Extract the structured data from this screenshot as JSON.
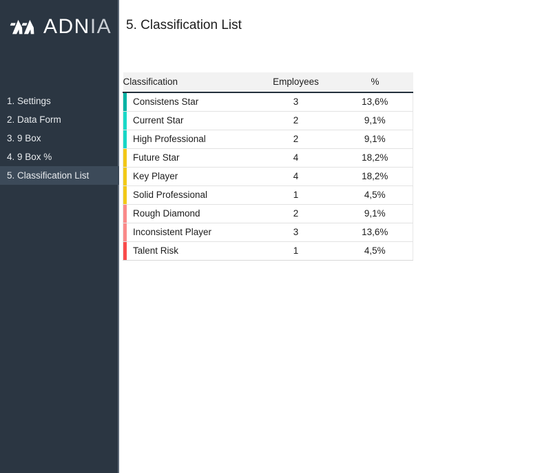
{
  "brand": {
    "logo_icon": "adnia-monogram-icon",
    "name_strong": "ADN",
    "name_light": "IA"
  },
  "sidebar": {
    "items": [
      {
        "label": "1. Settings",
        "active": false
      },
      {
        "label": "2. Data Form",
        "active": false
      },
      {
        "label": "3. 9 Box",
        "active": false
      },
      {
        "label": "4. 9 Box %",
        "active": false
      },
      {
        "label": "5. Classification List",
        "active": true
      }
    ],
    "background": "#2b3642",
    "active_background": "#3c4a59"
  },
  "main": {
    "page_title": "5. Classification List"
  },
  "table": {
    "headers": {
      "classification": "Classification",
      "employees": "Employees",
      "percent": "%"
    },
    "rows": [
      {
        "classification": "Consistens Star",
        "employees": "3",
        "percent": "13,6%",
        "color": "#00b3a4"
      },
      {
        "classification": "Current Star",
        "employees": "2",
        "percent": "9,1%",
        "color": "#1ad9c8"
      },
      {
        "classification": "High Professional",
        "employees": "2",
        "percent": "9,1%",
        "color": "#18d6c6"
      },
      {
        "classification": "Future Star",
        "employees": "4",
        "percent": "18,2%",
        "color": "#f2c718"
      },
      {
        "classification": "Key Player",
        "employees": "4",
        "percent": "18,2%",
        "color": "#f2ca18"
      },
      {
        "classification": "Solid Professional",
        "employees": "1",
        "percent": "4,5%",
        "color": "#f2c918"
      },
      {
        "classification": "Rough Diamond",
        "employees": "2",
        "percent": "9,1%",
        "color": "#fa8a8a"
      },
      {
        "classification": "Inconsistent Player",
        "employees": "3",
        "percent": "13,6%",
        "color": "#fa8a8a"
      },
      {
        "classification": "Talent Risk",
        "employees": "1",
        "percent": "4,5%",
        "color": "#fa4b4b"
      }
    ]
  }
}
